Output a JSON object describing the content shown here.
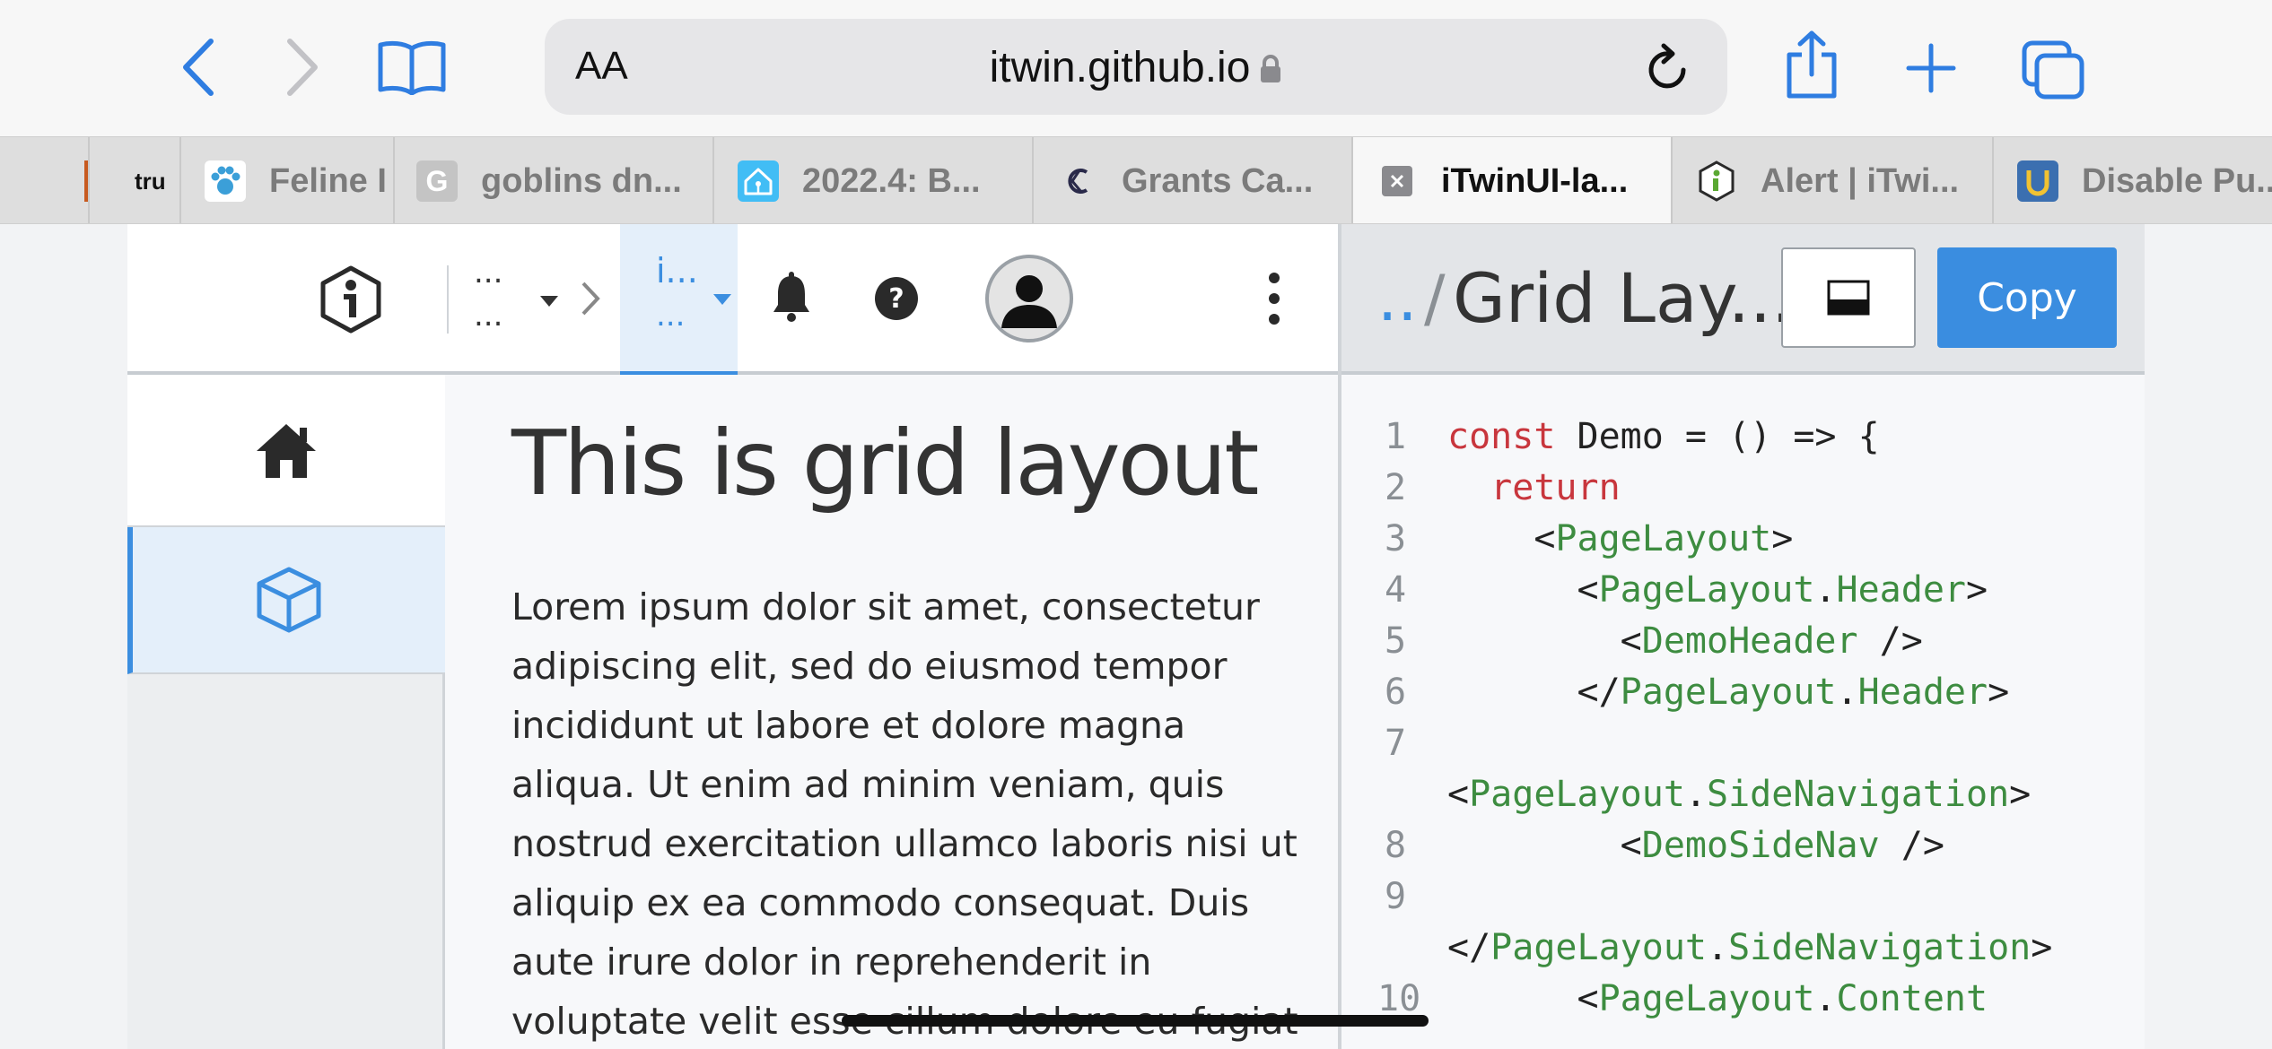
{
  "browser": {
    "text_size_button": "AA",
    "url": "itwin.github.io",
    "colors": {
      "accent": "#2f7de1",
      "toolbar_bg": "#f7f7f7",
      "address_bg": "#e6e6e8"
    },
    "icons": [
      "back-icon",
      "forward-icon",
      "bookmarks-icon",
      "lock-icon",
      "reload-icon",
      "share-icon",
      "new-tab-icon",
      "tab-overview-icon"
    ]
  },
  "tabs": [
    {
      "label": "",
      "favicon": "orange-stripe-icon",
      "active": false
    },
    {
      "label": "tru",
      "favicon": "trutv-icon",
      "active": false
    },
    {
      "label": "Feline I",
      "favicon": "paw-icon",
      "active": false
    },
    {
      "label": "goblins dn...",
      "favicon": "letter-g-icon",
      "active": false
    },
    {
      "label": "2022.4: B...",
      "favicon": "home-assistant-icon",
      "active": false
    },
    {
      "label": "Grants Ca...",
      "favicon": "grants-logo-icon",
      "active": false
    },
    {
      "label": "iTwinUI-la...",
      "favicon": "close-tab-icon",
      "active": true
    },
    {
      "label": "Alert | iTwi...",
      "favicon": "itwin-logo-icon",
      "active": false
    },
    {
      "label": "Disable Pu...",
      "favicon": "u-logo-icon",
      "active": false
    }
  ],
  "demo": {
    "header": {
      "breadcrumb_top": "...",
      "breadcrumb_bottom": "...",
      "active_top": "i...",
      "active_bottom": "..."
    },
    "content": {
      "title": "This is grid layout",
      "body": "Lorem ipsum dolor sit amet, consectetur adipiscing elit, sed do eiusmod tempor incididunt ut labore et dolore magna aliqua. Ut enim ad minim veniam, quis nostrud exercitation ullamco laboris nisi ut aliquip ex ea commodo consequat. Duis aute irure dolor in reprehenderit in voluptate velit esse cillum dolore eu fugiat"
    }
  },
  "code_pane": {
    "crumb_parent": "..",
    "crumb_sep": "/",
    "title": "Grid Lay...",
    "copy_label": "Copy",
    "lines": [
      {
        "n": "1",
        "parts": [
          [
            "kw",
            "const"
          ],
          [
            "",
            " Demo = () => {"
          ]
        ]
      },
      {
        "n": "2",
        "parts": [
          [
            "",
            "  "
          ],
          [
            "kw",
            "return"
          ]
        ]
      },
      {
        "n": "3",
        "parts": [
          [
            "",
            "    <"
          ],
          [
            "tag",
            "PageLayout"
          ],
          [
            "",
            ">"
          ]
        ]
      },
      {
        "n": "4",
        "parts": [
          [
            "",
            "      <"
          ],
          [
            "tag",
            "PageLayout"
          ],
          [
            "",
            "."
          ],
          [
            "tag",
            "Header"
          ],
          [
            "",
            ">"
          ]
        ]
      },
      {
        "n": "5",
        "parts": [
          [
            "",
            "        <"
          ],
          [
            "tag",
            "DemoHeader"
          ],
          [
            "",
            " />"
          ]
        ]
      },
      {
        "n": "6",
        "parts": [
          [
            "",
            "      </"
          ],
          [
            "tag",
            "PageLayout"
          ],
          [
            "",
            "."
          ],
          [
            "tag",
            "Header"
          ],
          [
            "",
            ">"
          ]
        ]
      },
      {
        "n": "7",
        "parts": []
      },
      {
        "n": "",
        "parts": [
          [
            "",
            "<"
          ],
          [
            "tag",
            "PageLayout"
          ],
          [
            "",
            "."
          ],
          [
            "tag",
            "SideNavigation"
          ],
          [
            "",
            ">"
          ]
        ]
      },
      {
        "n": "8",
        "parts": [
          [
            "",
            "        <"
          ],
          [
            "tag",
            "DemoSideNav"
          ],
          [
            "",
            " />"
          ]
        ]
      },
      {
        "n": "9",
        "parts": []
      },
      {
        "n": "",
        "parts": [
          [
            "",
            "</"
          ],
          [
            "tag",
            "PageLayout"
          ],
          [
            "",
            "."
          ],
          [
            "tag",
            "SideNavigation"
          ],
          [
            "",
            ">"
          ]
        ]
      },
      {
        "n": "10",
        "parts": [
          [
            "",
            "      <"
          ],
          [
            "tag",
            "PageLayout"
          ],
          [
            "",
            "."
          ],
          [
            "tag",
            "Content"
          ]
        ]
      }
    ]
  }
}
